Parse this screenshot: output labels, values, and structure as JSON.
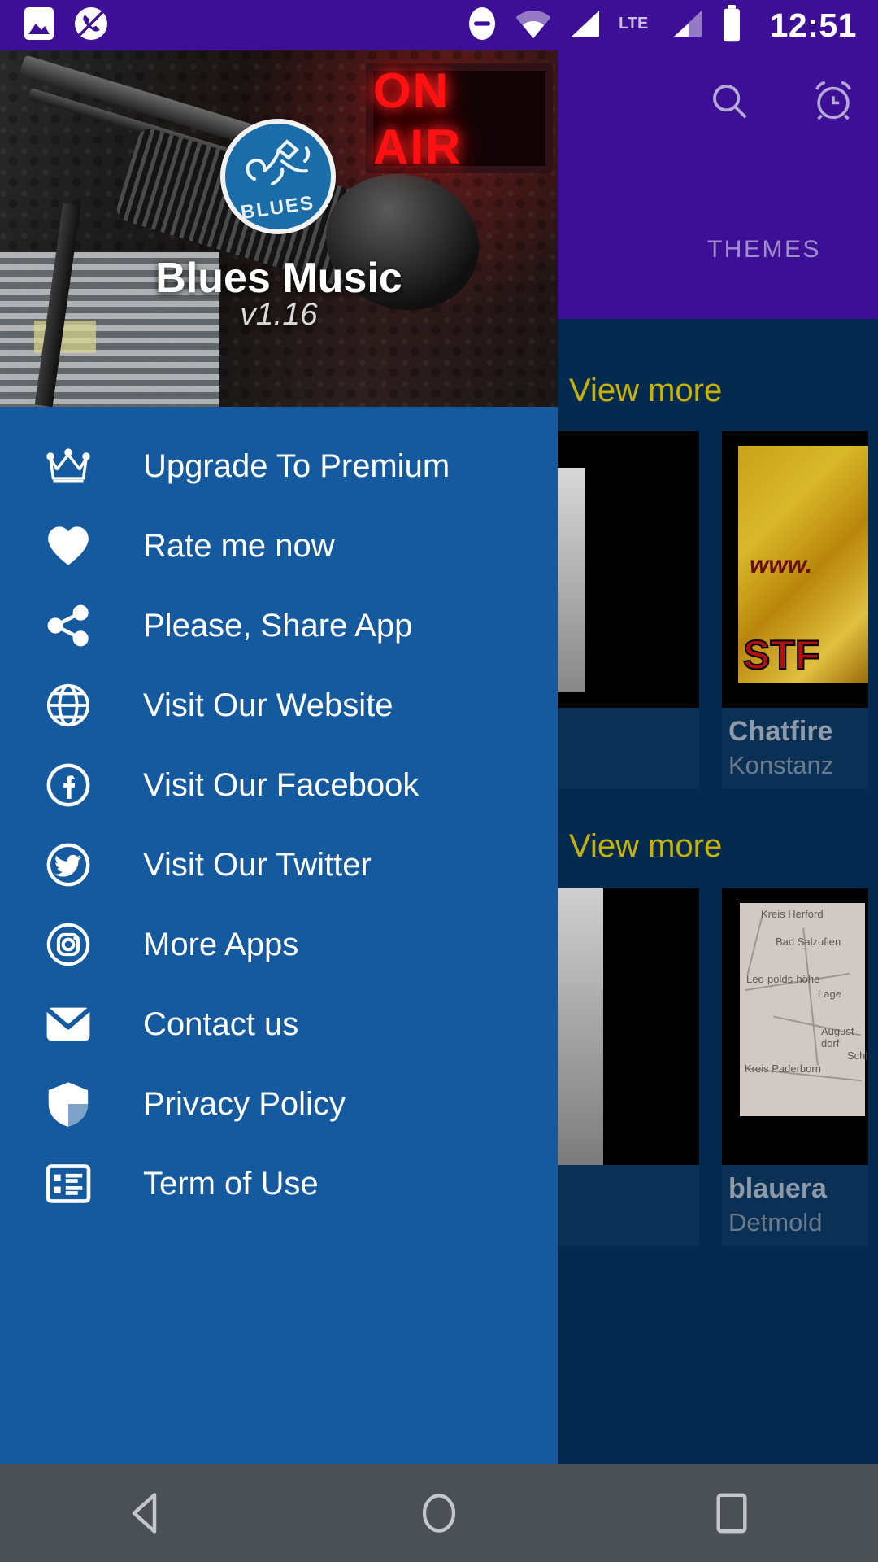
{
  "statusbar": {
    "time": "12:51",
    "left_icons": [
      "image-icon",
      "missed-call-icon"
    ],
    "right_icons": [
      "do-not-disturb-icon",
      "wifi-icon",
      "signal-icon",
      "lte-label",
      "signal2-icon",
      "battery-icon"
    ],
    "lte_label": "LTE",
    "background_color": "#3d0e96"
  },
  "background_app": {
    "appbar_color": "#3d0e96",
    "actions": [
      {
        "name": "search-icon",
        "label": "Search"
      },
      {
        "name": "alarm-icon",
        "label": "Alarm"
      }
    ],
    "tabs": [
      {
        "label": "THEMES"
      }
    ],
    "view_more_1": "View more",
    "view_more_2": "View more",
    "view_more_color": "#c8b400",
    "cards_row_1": [
      {
        "title": "",
        "subtitle": ""
      },
      {
        "title": "Chatfire",
        "subtitle": "Konstanz"
      }
    ],
    "cards_row_2": [
      {
        "title": "",
        "subtitle": ""
      },
      {
        "title": "blauera",
        "subtitle": "Detmold"
      }
    ],
    "thumb_texts": {
      "www": "www.",
      "stf": "STF",
      "map_label_1": "Kreis Herford",
      "map_label_2": "Bad Salzuflen",
      "map_label_3": "Leo-polds-höhe",
      "map_label_4": "Lage",
      "map_label_5": "August-dorf",
      "map_label_6": "Kreis Paderborn",
      "map_label_7": "Schla"
    }
  },
  "drawer": {
    "background_color": "#15599f",
    "header": {
      "logo_name": "blues-logo",
      "logo_word": "BLUES",
      "on_air_sign": "ON AIR",
      "app_name": "Blues Music",
      "version": "v1.16"
    },
    "items": [
      {
        "icon": "crown-icon",
        "label": "Upgrade To Premium"
      },
      {
        "icon": "heart-icon",
        "label": "Rate me now"
      },
      {
        "icon": "share-icon",
        "label": "Please, Share App"
      },
      {
        "icon": "globe-icon",
        "label": "Visit Our Website"
      },
      {
        "icon": "facebook-icon",
        "label": "Visit Our Facebook"
      },
      {
        "icon": "twitter-icon",
        "label": "Visit Our Twitter"
      },
      {
        "icon": "instagram-icon",
        "label": "More Apps"
      },
      {
        "icon": "mail-icon",
        "label": "Contact us"
      },
      {
        "icon": "shield-icon",
        "label": "Privacy Policy"
      },
      {
        "icon": "list-icon",
        "label": "Term of Use"
      }
    ]
  },
  "navbar": {
    "background_color": "#4a5056",
    "buttons": [
      {
        "name": "back-button",
        "label": "Back"
      },
      {
        "name": "home-button",
        "label": "Home"
      },
      {
        "name": "recents-button",
        "label": "Recents"
      }
    ]
  }
}
